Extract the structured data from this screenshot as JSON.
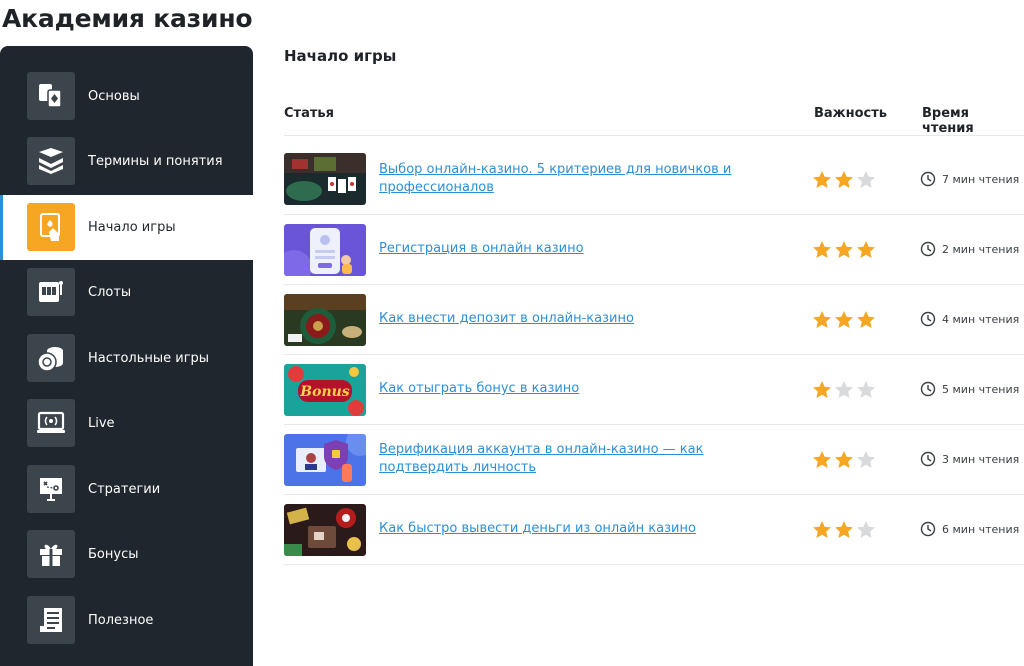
{
  "page": {
    "title": "Академия казино"
  },
  "sidebar": {
    "items": [
      {
        "label": "Основы",
        "icon": "cards-diamond-icon"
      },
      {
        "label": "Термины и понятия",
        "icon": "books-icon"
      },
      {
        "label": "Начало игры",
        "icon": "card-hand-icon",
        "active": true
      },
      {
        "label": "Слоты",
        "icon": "slot-machine-icon"
      },
      {
        "label": "Настольные игры",
        "icon": "chips-icon"
      },
      {
        "label": "Live",
        "icon": "live-stream-icon"
      },
      {
        "label": "Стратегии",
        "icon": "strategy-board-icon"
      },
      {
        "label": "Бонусы",
        "icon": "gift-icon"
      },
      {
        "label": "Полезное",
        "icon": "document-list-icon"
      }
    ]
  },
  "main": {
    "section_title": "Начало игры",
    "columns": {
      "article": "Статья",
      "importance": "Важность",
      "read_time": "Время чтения"
    },
    "articles": [
      {
        "title": "Выбор онлайн-казино. 5 критериев для новичков и профессионалов",
        "stars": 2,
        "read_time": "7 мин чтения"
      },
      {
        "title": "Регистрация в онлайн казино",
        "stars": 3,
        "read_time": "2 мин чтения"
      },
      {
        "title": "Как внести депозит в онлайн-казино",
        "stars": 3,
        "read_time": "4 мин чтения"
      },
      {
        "title": "Как отыграть бонус в казино",
        "stars": 1,
        "read_time": "5 мин чтения",
        "thumb_text": "Bonus"
      },
      {
        "title": "Верификация аккаунта в онлайн-казино — как подтвердить личность",
        "stars": 2,
        "read_time": "3 мин чтения"
      },
      {
        "title": "Как быстро вывести деньги из онлайн казино",
        "stars": 2,
        "read_time": "6 мин чтения"
      }
    ]
  },
  "colors": {
    "sidebar_bg": "#1f262d",
    "icon_bg": "#3c444c",
    "accent": "#f5a623",
    "link": "#2c8fd6",
    "star_on": "#f5a623",
    "star_off": "#d8dadc"
  }
}
